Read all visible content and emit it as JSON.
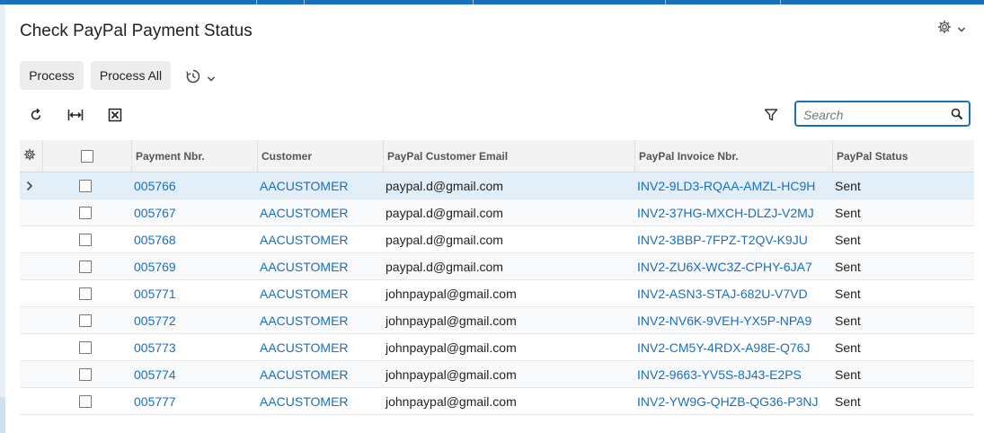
{
  "page": {
    "title": "Check PayPal Payment Status",
    "settings_icon": "gear-icon",
    "settings_chevron": "chevron-down-icon"
  },
  "actions": {
    "process_label": "Process",
    "process_all_label": "Process All",
    "schedule_icon": "schedule-icon"
  },
  "toolbar": {
    "refresh_icon": "refresh-icon",
    "fit_columns_icon": "fit-columns-icon",
    "export_excel_icon": "excel-export-icon",
    "filter_icon": "filter-icon"
  },
  "search": {
    "placeholder": "Search",
    "value": ""
  },
  "grid": {
    "columns": [
      "Payment Nbr.",
      "Customer",
      "PayPal Customer Email",
      "PayPal Invoice Nbr.",
      "PayPal Status"
    ],
    "rows": [
      {
        "payment_nbr": "005766",
        "customer": "AACUSTOMER",
        "email": "paypal.d@gmail.com",
        "invoice": "INV2-9LD3-RQAA-AMZL-HC9H",
        "status": "Sent"
      },
      {
        "payment_nbr": "005767",
        "customer": "AACUSTOMER",
        "email": "paypal.d@gmail.com",
        "invoice": "INV2-37HG-MXCH-DLZJ-V2MJ",
        "status": "Sent"
      },
      {
        "payment_nbr": "005768",
        "customer": "AACUSTOMER",
        "email": "paypal.d@gmail.com",
        "invoice": "INV2-3BBP-7FPZ-T2QV-K9JU",
        "status": "Sent"
      },
      {
        "payment_nbr": "005769",
        "customer": "AACUSTOMER",
        "email": "paypal.d@gmail.com",
        "invoice": "INV2-ZU6X-WC3Z-CPHY-6JA7",
        "status": "Sent"
      },
      {
        "payment_nbr": "005771",
        "customer": "AACUSTOMER",
        "email": "johnpaypal@gmail.com",
        "invoice": "INV2-ASN3-STAJ-682U-V7VD",
        "status": "Sent"
      },
      {
        "payment_nbr": "005772",
        "customer": "AACUSTOMER",
        "email": "johnpaypal@gmail.com",
        "invoice": "INV2-NV6K-9VEH-YX5P-NPA9",
        "status": "Sent"
      },
      {
        "payment_nbr": "005773",
        "customer": "AACUSTOMER",
        "email": "johnpaypal@gmail.com",
        "invoice": "INV2-CM5Y-4RDX-A98E-Q76J",
        "status": "Sent"
      },
      {
        "payment_nbr": "005774",
        "customer": "AACUSTOMER",
        "email": "johnpaypal@gmail.com",
        "invoice": "INV2-9663-YV5S-8J43-E2PS",
        "status": "Sent"
      },
      {
        "payment_nbr": "005777",
        "customer": "AACUSTOMER",
        "email": "johnpaypal@gmail.com",
        "invoice": "INV2-YW9G-QHZB-QG36-P3NJ",
        "status": "Sent"
      }
    ]
  },
  "colors": {
    "accent": "#1a6fbf",
    "selected_row": "#e2eef8"
  }
}
